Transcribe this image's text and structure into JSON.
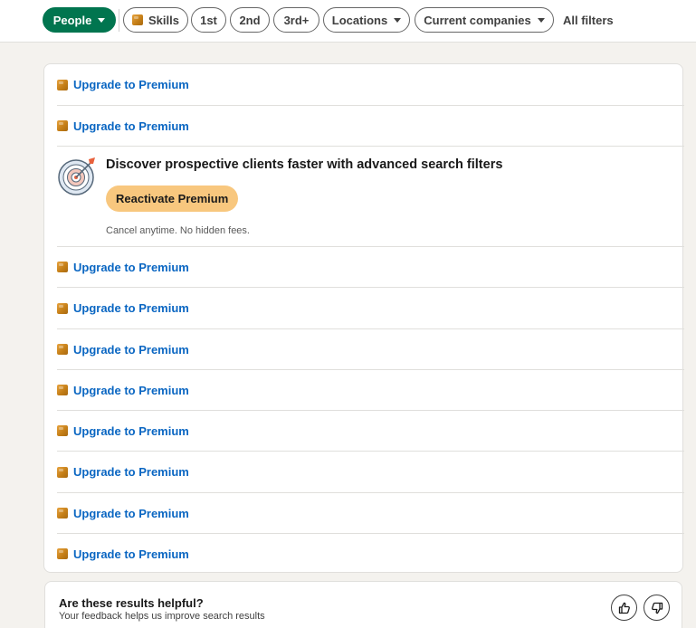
{
  "filters": {
    "people": "People",
    "skills": "Skills",
    "first": "1st",
    "second": "2nd",
    "third": "3rd+",
    "locations": "Locations",
    "current_companies": "Current companies",
    "all_filters": "All filters"
  },
  "results": {
    "upgrade_label": "Upgrade to Premium",
    "promo": {
      "title": "Discover prospective clients faster with advanced search filters",
      "button": "Reactivate Premium",
      "note": "Cancel anytime. No hidden fees."
    }
  },
  "feedback": {
    "title": "Are these results helpful?",
    "subtitle": "Your feedback helps us improve search results"
  },
  "colors": {
    "people_active": "#01754f",
    "link": "#0a66c2",
    "premium_button": "#f8c77e",
    "premium_badge": "#c37d16"
  },
  "icons": [
    "caret-down-icon",
    "premium-badge-icon",
    "target-icon",
    "thumbs-up-icon",
    "thumbs-down-icon"
  ]
}
